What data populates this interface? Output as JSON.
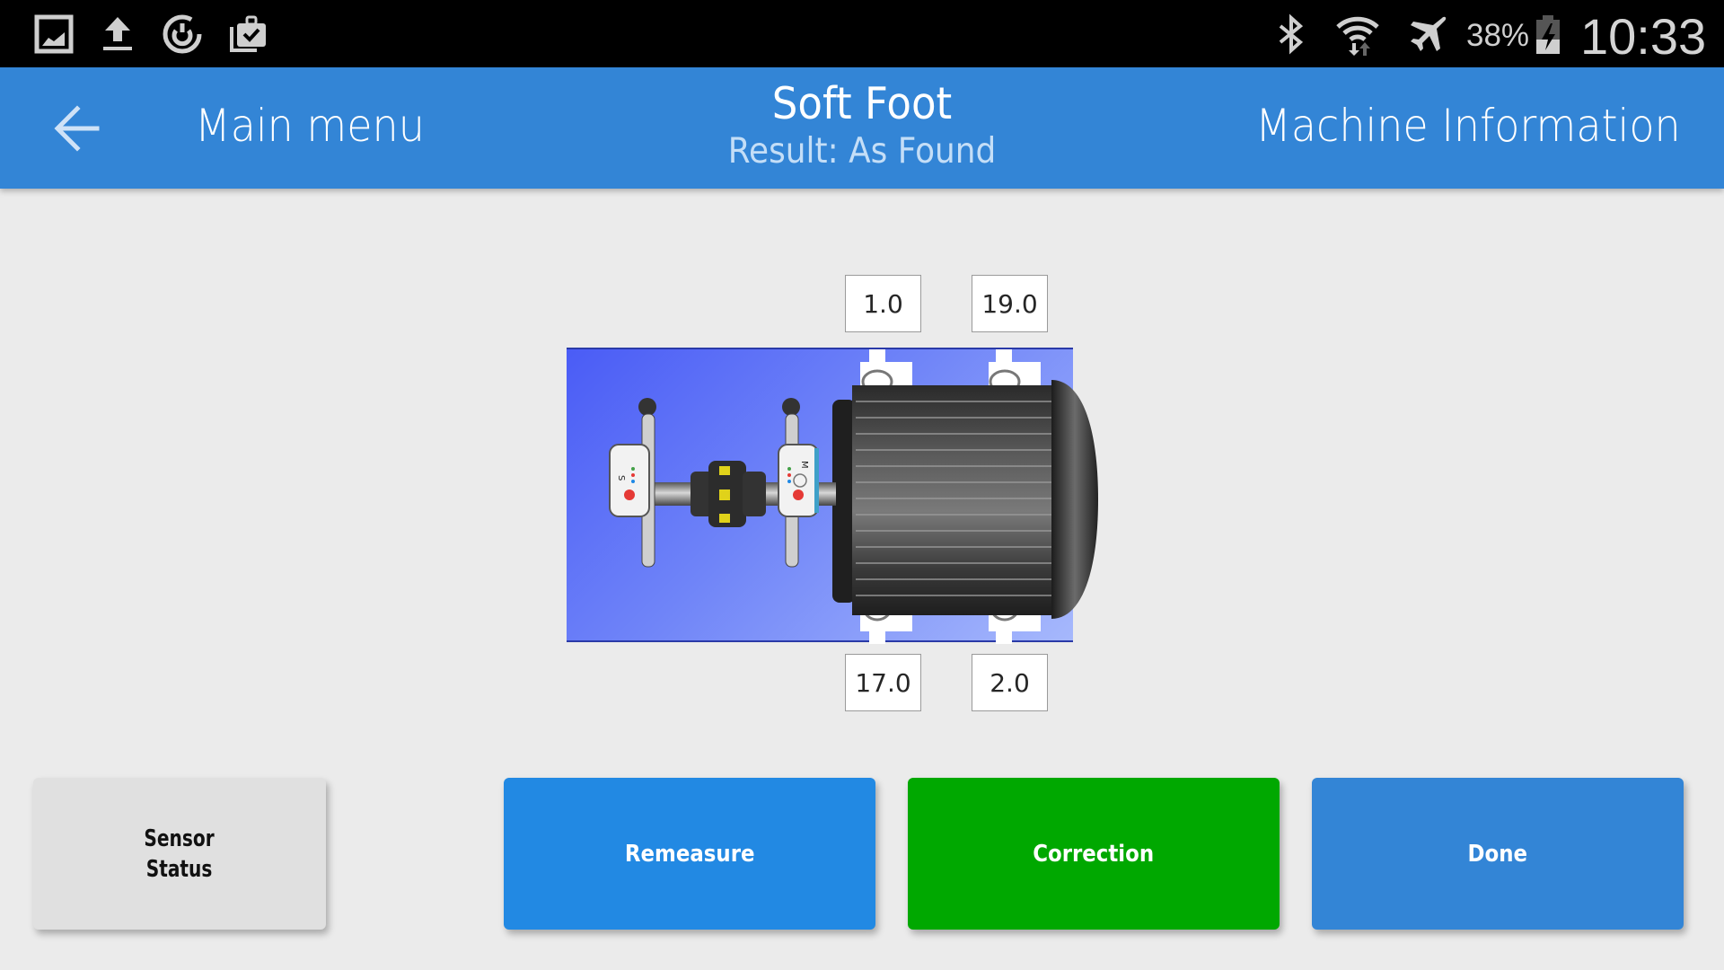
{
  "status_bar": {
    "left_icons": [
      "gallery-icon",
      "upload-icon",
      "sync-power-icon",
      "briefcase-check-icon"
    ],
    "right_icons": [
      "bluetooth-icon",
      "wifi-icon",
      "airplane-mode-icon",
      "battery-charging-icon"
    ],
    "battery_percent": "38%",
    "battery_level": 0.38,
    "clock": "10:33"
  },
  "header": {
    "back_label": "Main menu",
    "title": "Soft Foot",
    "subtitle": "Result: As Found",
    "right_link": "Machine Information",
    "color": "#3385d6"
  },
  "diagram": {
    "description": "Motor with coupling and sensors (S and M) on blue base",
    "sensor_labels": [
      "S",
      "M"
    ],
    "feet_values": {
      "front_top": "1.0",
      "rear_top": "19.0",
      "front_bottom": "17.0",
      "rear_bottom": "2.0"
    }
  },
  "buttons": {
    "sensor_status_line1": "Sensor",
    "sensor_status_line2": "Status",
    "remeasure": "Remeasure",
    "correction": "Correction",
    "done": "Done"
  },
  "colors": {
    "remeasure": "#2289e3",
    "correction": "#00a800",
    "done": "#3385d6",
    "sensor_status": "#e0e0e0"
  }
}
